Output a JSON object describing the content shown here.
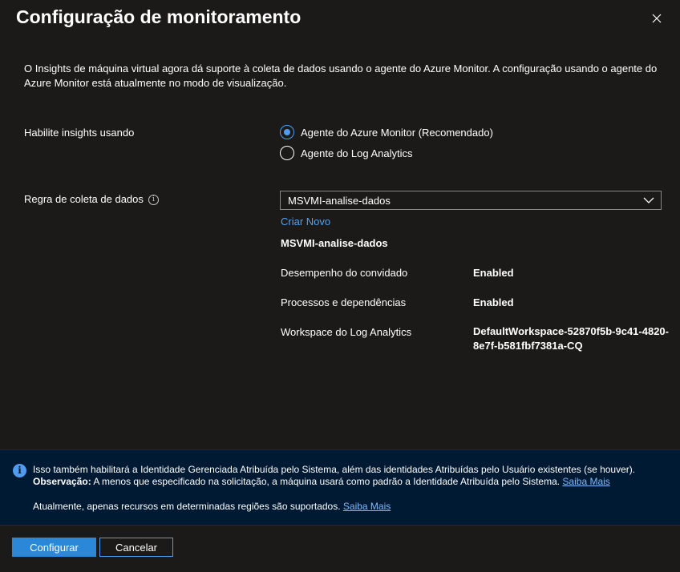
{
  "header": {
    "title": "Configuração de monitoramento",
    "close_icon": "close-icon"
  },
  "intro": {
    "text": "O Insights de máquina virtual agora dá suporte à coleta de dados usando o agente do Azure Monitor. A configuração usando o agente do Azure Monitor está atualmente no modo de visualização."
  },
  "enable": {
    "label": "Habilite insights usando",
    "options": [
      {
        "label": "Agente do Azure Monitor (Recomendado)",
        "checked": true
      },
      {
        "label": "Agente do Log Analytics",
        "checked": false
      }
    ]
  },
  "dcr": {
    "label": "Regra de coleta de dados",
    "info_icon": "info-icon",
    "selected": "MSVMI-analise-dados",
    "create_new": "Criar Novo",
    "rule_name": "MSVMI-analise-dados",
    "properties": [
      {
        "label": "Desempenho do convidado",
        "value": "Enabled"
      },
      {
        "label": "Processos e dependências",
        "value": "Enabled"
      },
      {
        "label": "Workspace do Log Analytics",
        "value": "DefaultWorkspace-52870f5b-9c41-4820-8e7f-b581fbf7381a-CQ"
      }
    ]
  },
  "banner": {
    "line1": "Isso também habilitará a Identidade Gerenciada Atribuída pelo Sistema, além das identidades Atribuídas pelo Usuário existentes (se houver).",
    "note_bold": "Observação:",
    "note_text": " A menos que especificado na solicitação, a máquina usará como padrão a Identidade Atribuída pelo Sistema.",
    "learn_more_1": "Saiba Mais",
    "line3": "Atualmente, apenas recursos em determinadas regiões são suportados.",
    "learn_more_2": "Saiba Mais"
  },
  "footer": {
    "configure": "Configurar",
    "cancel": "Cancelar"
  },
  "colors": {
    "background": "#1b1a19",
    "accent": "#4f9cf0",
    "banner_bg": "#001a33",
    "primary_button": "#2b88d8"
  }
}
